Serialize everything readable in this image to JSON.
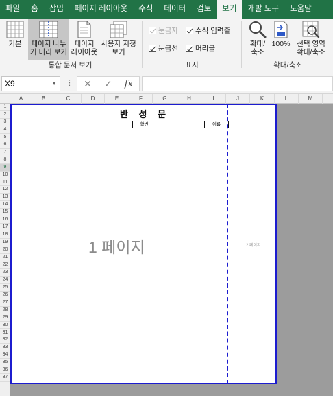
{
  "menu": {
    "tabs": [
      "파일",
      "홈",
      "삽입",
      "페이지 레이아웃",
      "수식",
      "데이터",
      "검토",
      "보기",
      "개발 도구",
      "도움말"
    ],
    "active_index": 7
  },
  "ribbon": {
    "workbook_views": {
      "group_label": "통합 문서 보기",
      "normal": "기본",
      "page_break_line1": "페이지 나누",
      "page_break_line2": "기 미리 보기",
      "page_layout_line1": "페이지",
      "page_layout_line2": "레이아웃",
      "custom_line1": "사용자 지정",
      "custom_line2": "보기"
    },
    "show": {
      "group_label": "표시",
      "ruler": "눈금자",
      "formula_bar": "수식 입력줄",
      "gridlines": "눈금선",
      "headings": "머리글"
    },
    "zoom": {
      "group_label": "확대/축소",
      "zoom_line1": "확대/",
      "zoom_line2": "축소",
      "hundred": "100%",
      "selection_line1": "선택 영역",
      "selection_line2": "확대/축소"
    }
  },
  "formula_bar": {
    "name_box": "X9",
    "dots": "⋮",
    "cancel": "✕",
    "enter": "✓",
    "fx": "fx",
    "value": ""
  },
  "columns": [
    "A",
    "B",
    "C",
    "D",
    "E",
    "F",
    "G",
    "H",
    "I",
    "J",
    "K",
    "L",
    "M"
  ],
  "rows": [
    "1",
    "2",
    "3",
    "4",
    "5",
    "6",
    "7",
    "8",
    "9",
    "10",
    "11",
    "12",
    "13",
    "14",
    "15",
    "16",
    "17",
    "18",
    "19",
    "20",
    "21",
    "22",
    "23",
    "24",
    "25",
    "26",
    "27",
    "28",
    "29",
    "30",
    "31",
    "32",
    "33",
    "34",
    "35",
    "36",
    "37"
  ],
  "selected_row": "9",
  "sheet": {
    "title": "반 성 문",
    "student_id_label": "학번",
    "name_label": "이름",
    "page1_label": "1 페이지",
    "page2_label": "2 페이지"
  }
}
